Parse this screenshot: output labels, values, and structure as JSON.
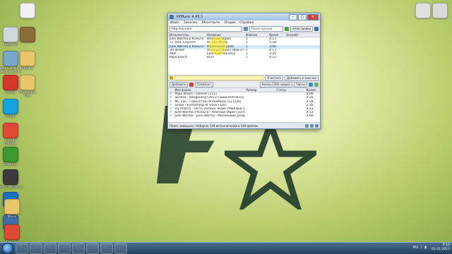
{
  "desktop": {
    "icons_left": [
      {
        "label": "Корзина",
        "color": "#cfd8dc"
      },
      {
        "label": "Windows Live Movie Maker",
        "color": "#7aa6c9"
      },
      {
        "label": "Opera",
        "color": "#d7342b"
      },
      {
        "label": "Skype",
        "color": "#14a2e0"
      },
      {
        "label": "Google Chrome",
        "color": "#e04a33"
      },
      {
        "label": "uTorrent",
        "color": "#3c9a33"
      },
      {
        "label": "Aleks Windows",
        "color": "#3b3b3b"
      },
      {
        "label": "HP",
        "color": "#1b70c4"
      },
      {
        "label": "VKMusic",
        "color": "#3f6fa3"
      }
    ],
    "icons_left2": [
      {
        "label": "",
        "color": "#f0f0f0"
      },
      {
        "label": "",
        "color": "#8a6d3b"
      },
      {
        "label": "Папка",
        "color": "#e9c66a"
      },
      {
        "label": "Photoshop Files",
        "color": "#e9c66a"
      }
    ],
    "icons_right": [
      {
        "label": "",
        "color": "#e0e0e0"
      },
      {
        "label": "",
        "color": "#dadada"
      }
    ],
    "bottom_icons": [
      {
        "label": "Music",
        "color": "#e9c66a"
      },
      {
        "label": "Google Chrome",
        "color": "#e04a33"
      }
    ]
  },
  "window": {
    "title": "VKMusic 4.45.1",
    "menu": [
      "Файл",
      "Закачка",
      "ВКонтакте",
      "Опции",
      "Справка"
    ],
    "url": "http://vk.com/",
    "search_placeholder": "Поиск музыки",
    "settings_label": "Настройки",
    "results_headers": [
      "Исполнитель",
      "Название",
      "Файлов",
      "Время",
      "Битрейт"
    ],
    "results": [
      {
        "artist": "Julie Warma и Коньга",
        "title": "Нежный образ",
        "files": "1",
        "time": "4:13",
        "bitrate": ""
      },
      {
        "artist": "T.I. feat. Eminem",
        "title": "All She Wrote",
        "files": "1",
        "time": "5:18",
        "bitrate": ""
      },
      {
        "artist": "Julie Warma и Коньга",
        "title": "Маленькие роли",
        "files": "1",
        "time": "3:00",
        "bitrate": ""
      },
      {
        "artist": "3H Street",
        "title": "Нежный образ твой и се...",
        "files": "1",
        "time": "4:13",
        "bitrate": ""
      },
      {
        "artist": "MEK",
        "title": "красный показки",
        "files": "1",
        "time": "3:20",
        "bitrate": ""
      },
      {
        "artist": "Papa Roach",
        "title": "Burn",
        "files": "1",
        "time": "4:13",
        "bitrate": ""
      }
    ],
    "clear_label": "Очистить",
    "add_label": "Добавить в закачки",
    "toolbar2": {
      "add": "Добавить",
      "playlist": "Плейлист",
      "clips": "Клипы (200 новых)",
      "charts": "Чарты"
    },
    "downloads_headers": [
      "Имя файла",
      "Размер",
      "Статус",
      "Время"
    ],
    "downloads": [
      {
        "name": "Papa Roach - Forever [211]",
        "time": "4:06"
      },
      {
        "name": "Skrillex - Bangarang (2011) [www.AntiHit.ru] [320]",
        "time": "3:35"
      },
      {
        "name": "MC Zali - Горностай (PrimeMusic.ru) [320]",
        "time": "3:28"
      },
      {
        "name": "Lenka - Everything At Once [320]",
        "time": "2:35"
      },
      {
        "name": "Fly Project - Лето, солнце, жаре тяжелый за угом [256]",
        "time": "3:13"
      },
      {
        "name": "Julie Warma и Коньга - Нежный образ [320]",
        "time": "4:13"
      },
      {
        "name": "Julie Warma - Julie Warma - Маленькие роли [320]",
        "time": "3:00"
      }
    ],
    "status_text": "Поиск завершен. Найдено 149 исполнителей в 149 файлах"
  },
  "taskbar": {
    "apps": [
      "Windows Explorer",
      "Media Player",
      "Firefox",
      "Opera",
      "uTorrent",
      "Skype",
      "VKMusic",
      "Photoshop"
    ],
    "lang": "RU",
    "time": "0:19",
    "date": "01.01.2013"
  }
}
